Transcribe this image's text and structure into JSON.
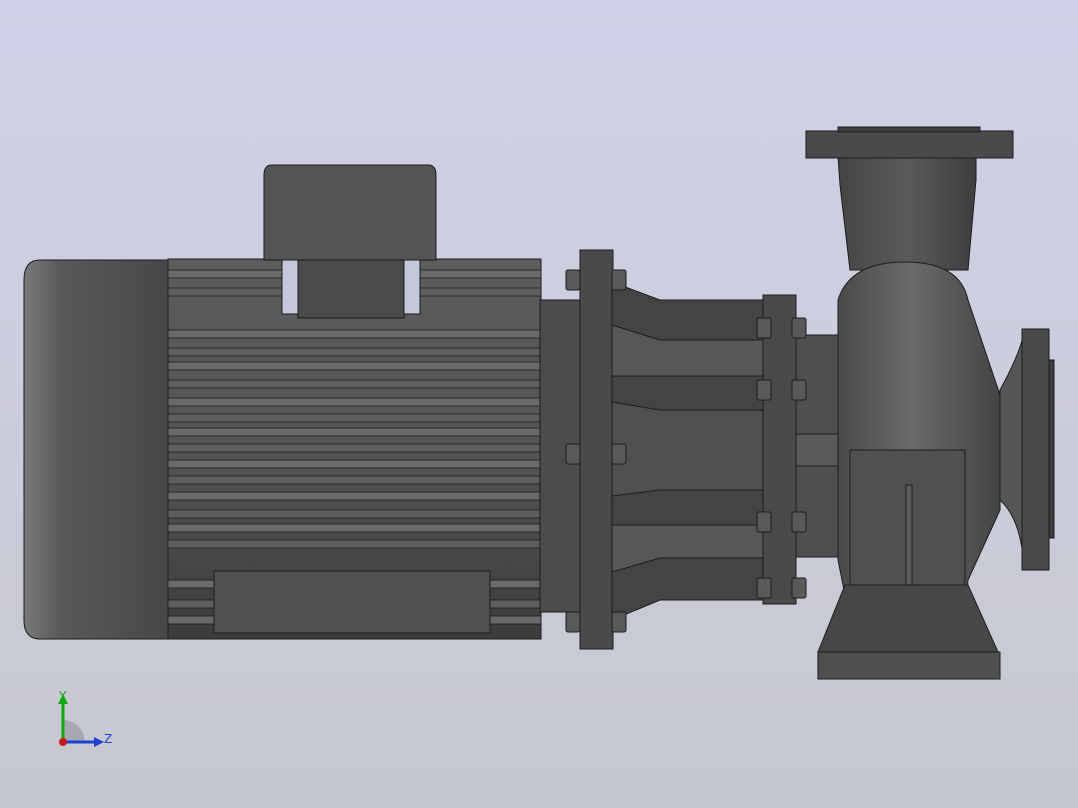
{
  "viewport": {
    "background_top": "#d1d1e9",
    "background_bottom": "#c6c8cf"
  },
  "model": {
    "description_icon": "centrifugal-pump-icon",
    "body_color": "#4f4f4f",
    "edge_color": "#1c1c1c"
  },
  "triad": {
    "y_label": "Y",
    "z_label": "Z",
    "y_color": "#11a811",
    "z_color": "#1e3fd0",
    "x_color": "#c81919"
  }
}
